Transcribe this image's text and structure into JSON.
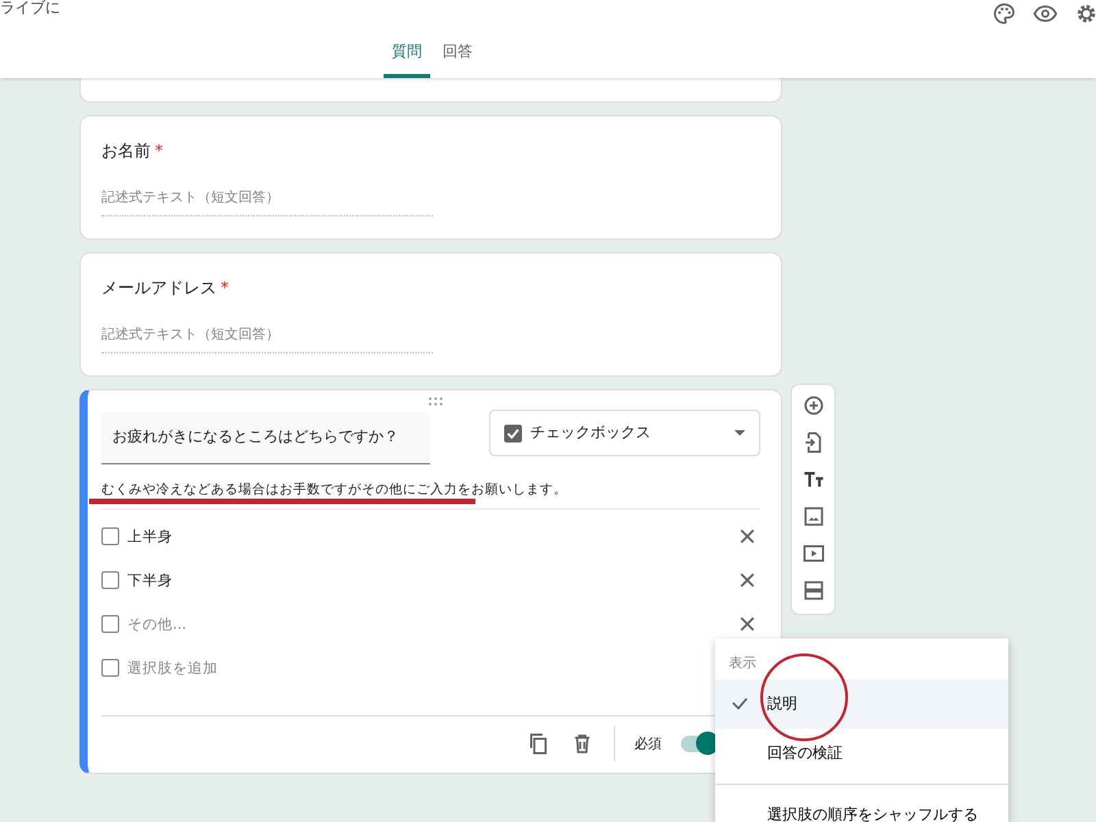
{
  "header": {
    "title": "ライブに",
    "tabs": [
      {
        "label": "質問",
        "selected": true
      },
      {
        "label": "回答",
        "selected": false
      }
    ]
  },
  "short_questions": [
    {
      "title": "お名前",
      "required": true,
      "required_mark": "*",
      "placeholder": "記述式テキスト（短文回答）"
    },
    {
      "title": "メールアドレス",
      "required": true,
      "required_mark": "*",
      "placeholder": "記述式テキスト（短文回答）"
    }
  ],
  "active_question": {
    "title": "お疲れがきになるところはどちらですか？",
    "type": "チェックボックス",
    "description": "むくみや冷えなどある場合はお手数ですがその他にご入力をお願いします。",
    "options": [
      {
        "kind": "option",
        "label": "上半身",
        "checked": false
      },
      {
        "kind": "option",
        "label": "下半身",
        "checked": false
      },
      {
        "kind": "other",
        "label": "その他...",
        "checked": false
      },
      {
        "kind": "add",
        "label": "選択肢を追加",
        "checked": false
      }
    ],
    "required_label": "必須",
    "required": true
  },
  "menu": {
    "heading": "表示",
    "items": [
      {
        "label": "説明",
        "checked": true,
        "selected": true
      },
      {
        "label": "回答の検証",
        "checked": false,
        "selected": false
      },
      {
        "label": "選択肢の順序をシャッフルする",
        "checked": false,
        "selected": false
      }
    ]
  }
}
